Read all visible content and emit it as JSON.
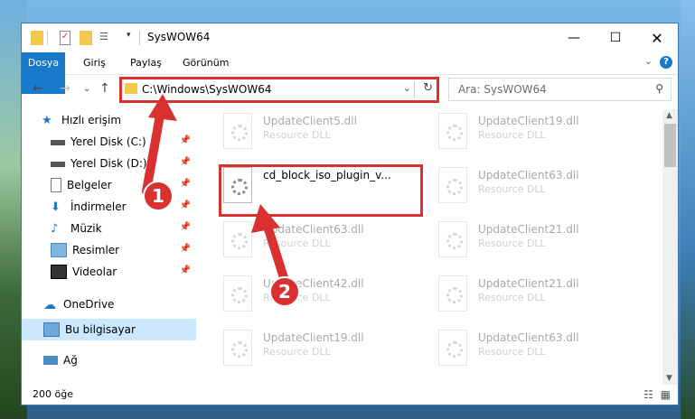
{
  "window": {
    "title": "SysWOW64"
  },
  "ribbon": {
    "tabs": [
      "Dosya",
      "Giriş",
      "Paylaş",
      "Görünüm"
    ],
    "help": "?"
  },
  "address": {
    "path": "C:\\Windows\\SysWOW64"
  },
  "search": {
    "placeholder": "Ara: SysWOW64"
  },
  "sidebar": {
    "items": [
      {
        "label": "Hızlı erişim"
      },
      {
        "label": "Yerel Disk (C:)"
      },
      {
        "label": "Yerel Disk (D:)"
      },
      {
        "label": "Belgeler"
      },
      {
        "label": "İndirmeler"
      },
      {
        "label": "Müzik"
      },
      {
        "label": "Resimler"
      },
      {
        "label": "Videolar"
      },
      {
        "label": "OneDrive"
      },
      {
        "label": "Bu bilgisayar"
      },
      {
        "label": "Ağ"
      }
    ]
  },
  "files": {
    "left": [
      {
        "name": "UpdateClient5.dll",
        "type": "Resource DLL"
      },
      {
        "name": "cd_block_iso_plugin_v...",
        "type": ""
      },
      {
        "name": "UpdateClient63.dll",
        "type": "Resource DLL"
      },
      {
        "name": "UpdateClient42.dll",
        "type": "Resource DLL"
      },
      {
        "name": "UpdateClient19.dll",
        "type": "Resource DLL"
      }
    ],
    "right": [
      {
        "name": "UpdateClient19.dll",
        "type": "Resource DLL"
      },
      {
        "name": "UpdateClient63.dll",
        "type": "Resource DLL"
      },
      {
        "name": "UpdateClient21.dll",
        "type": "Resource DLL"
      },
      {
        "name": "UpdateClient21.dll",
        "type": "Resource DLL"
      },
      {
        "name": "UpdateClient63.dll",
        "type": "Resource DLL"
      }
    ]
  },
  "status": {
    "count": "200 öğe"
  },
  "annotations": {
    "step1": "1",
    "step2": "2"
  },
  "colors": {
    "accent": "#1979ca",
    "highlight": "#d9312f"
  }
}
